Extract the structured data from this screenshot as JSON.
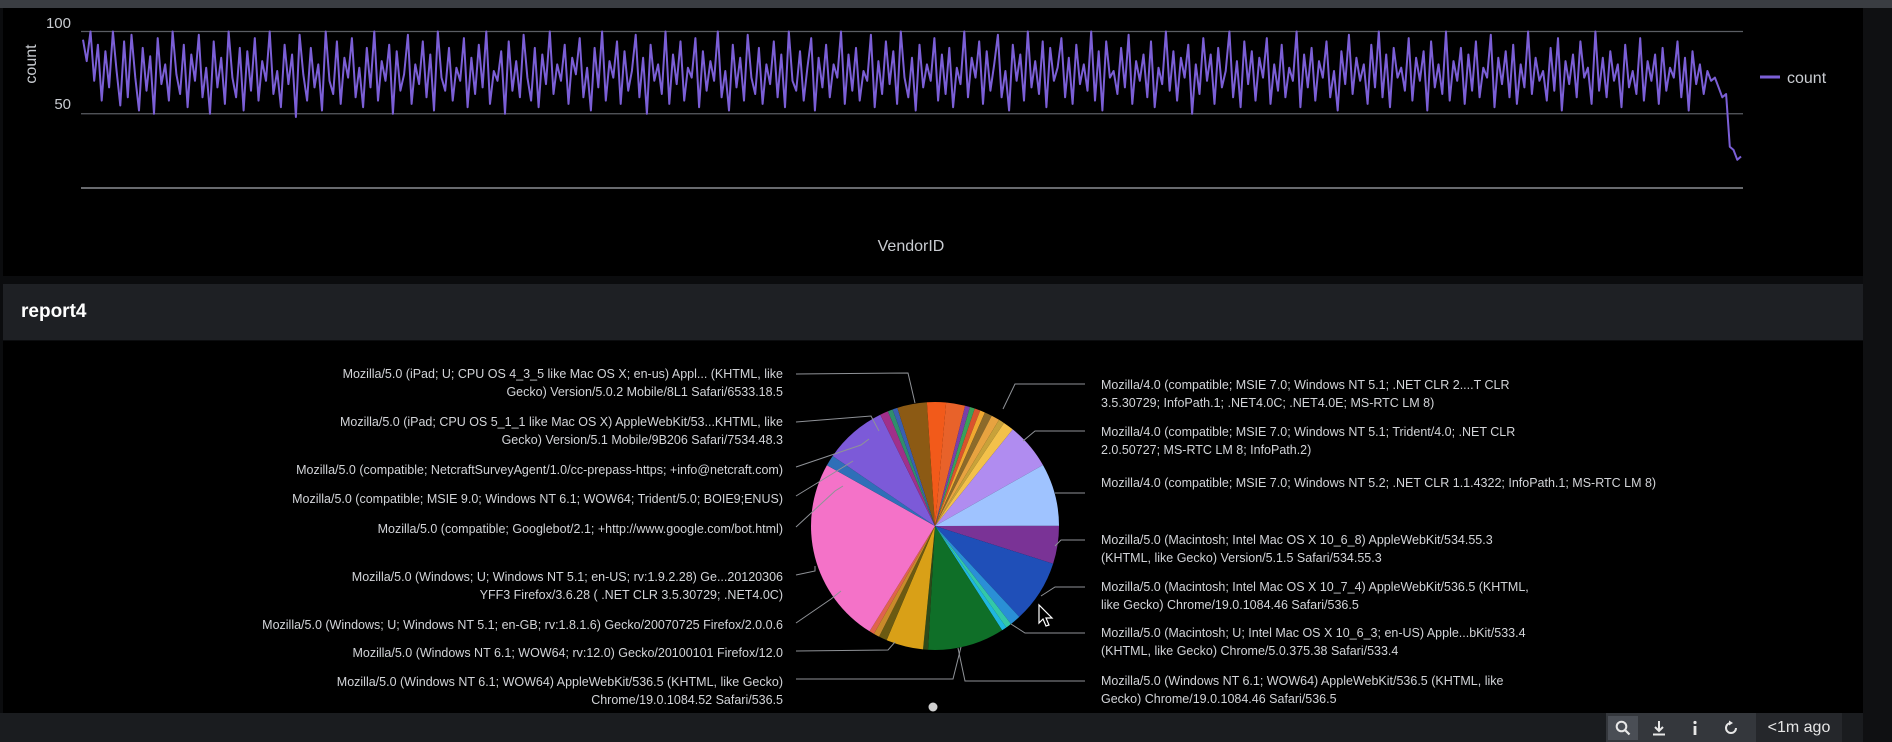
{
  "line_chart": {
    "ylabel": "count",
    "xlabel": "VendorID",
    "legend_label": "count",
    "line_color": "#7b5fd6"
  },
  "report": {
    "title": "report4"
  },
  "chart_data": [
    {
      "type": "line",
      "title": "",
      "xlabel": "VendorID",
      "ylabel": "count",
      "ylim": [
        0,
        110
      ],
      "yticks": [
        50,
        100
      ],
      "grid": true,
      "legend": "right",
      "series": [
        {
          "name": "count",
          "color": "#7b5fd6",
          "values": [
            95,
            82,
            100,
            70,
            92,
            58,
            88,
            66,
            100,
            76,
            55,
            94,
            60,
            98,
            72,
            52,
            90,
            64,
            85,
            50,
            96,
            68,
            80,
            58,
            100,
            74,
            62,
            92,
            54,
            86,
            70,
            98,
            60,
            78,
            50,
            94,
            66,
            84,
            56,
            100,
            72,
            60,
            90,
            52,
            88,
            64,
            96,
            58,
            82,
            70,
            100,
            62,
            76,
            54,
            92,
            68,
            86,
            48,
            98,
            74,
            58,
            90,
            66,
            80,
            52,
            100,
            70,
            62,
            94,
            56,
            84,
            72,
            96,
            60,
            78,
            54,
            90,
            66,
            100,
            58,
            82,
            70,
            92,
            50,
            88,
            64,
            74,
            98,
            56,
            80,
            68,
            94,
            60,
            86,
            52,
            100,
            72,
            64,
            90,
            58,
            78,
            70,
            96,
            54,
            84,
            62,
            92,
            66,
            100,
            56,
            76,
            70,
            88,
            50,
            94,
            64,
            82,
            60,
            98,
            72,
            58,
            90,
            54,
            86,
            68,
            100,
            62,
            80,
            70,
            92,
            56,
            84,
            74,
            96,
            60,
            78,
            52,
            90,
            66,
            100,
            58,
            82,
            72,
            94,
            56,
            88,
            64,
            76,
            98,
            60,
            84,
            50,
            92,
            70,
            80,
            62,
            100,
            56,
            86,
            68,
            94,
            58,
            78,
            72,
            96,
            54,
            88,
            64,
            82,
            70,
            100,
            60,
            76,
            52,
            92,
            66,
            84,
            58,
            98,
            72,
            62,
            90,
            56,
            80,
            68,
            94,
            60,
            86,
            54,
            100,
            70,
            64,
            88,
            58,
            78,
            96,
            52,
            84,
            66,
            92,
            60,
            80,
            72,
            100,
            56,
            86,
            64,
            90,
            58,
            76,
            70,
            98,
            54,
            82,
            62,
            94,
            68,
            88,
            56,
            100,
            72,
            60,
            84,
            52,
            92,
            66,
            80,
            70,
            96,
            58,
            86,
            62,
            90,
            54,
            78,
            68,
            100,
            60,
            84,
            72,
            94,
            56,
            88,
            64,
            80,
            98,
            60,
            76,
            52,
            92,
            70,
            86,
            58,
            100,
            66,
            82,
            62,
            94,
            54,
            90,
            70,
            78,
            96,
            60,
            84,
            56,
            92,
            68,
            80,
            64,
            100,
            58,
            88,
            52,
            94,
            72,
            76,
            62,
            90,
            66,
            98,
            56,
            82,
            70,
            86,
            60,
            94,
            54,
            78,
            68,
            100,
            64,
            88,
            58,
            84,
            72,
            92,
            50,
            80,
            62,
            96,
            70,
            86,
            56,
            90,
            66,
            76,
            100,
            60,
            82,
            54,
            94,
            68,
            88,
            58,
            84,
            72,
            96,
            56,
            80,
            64,
            92,
            60,
            78,
            70,
            100,
            54,
            86,
            66,
            90,
            58,
            82,
            72,
            94,
            60,
            76,
            52,
            88,
            68,
            98,
            62,
            84,
            70,
            80,
            56,
            92,
            66,
            100,
            60,
            86,
            54,
            90,
            72,
            78,
            64,
            96,
            58,
            84,
            70,
            88,
            52,
            94,
            66,
            80,
            62,
            100,
            58,
            82,
            70,
            90,
            56,
            86,
            64,
            94,
            60,
            78,
            72,
            98,
            54,
            84,
            68,
            88,
            60,
            92,
            56,
            80,
            66,
            100,
            62,
            84,
            70,
            76,
            58,
            90,
            64,
            96,
            52,
            82,
            68,
            86,
            60,
            94,
            72,
            78,
            56,
            100,
            64,
            84,
            60,
            88,
            70,
            80,
            54,
            92,
            66,
            76,
            62,
            96,
            58,
            82,
            70,
            86,
            56,
            90,
            64,
            78,
            72,
            94,
            60,
            84,
            52,
            88,
            68,
            80,
            62,
            76,
            70,
            72,
            66,
            60,
            62,
            30,
            28,
            22,
            24
          ]
        }
      ]
    },
    {
      "type": "pie",
      "title": "",
      "legend": "none",
      "labels_outside": [
        "Mozilla/5.0 (iPad; U; CPU OS 4_3_5 like Mac OS X; en-us) Appl... (KHTML, like Gecko) Version/5.0.2 Mobile/8L1 Safari/6533.18.5",
        "Mozilla/5.0 (iPad; CPU OS 5_1_1 like Mac OS X) AppleWebKit/53...KHTML, like Gecko) Version/5.1 Mobile/9B206 Safari/7534.48.3",
        "Mozilla/5.0 (compatible; NetcraftSurveyAgent/1.0/cc-prepass-https; +info@netcraft.com)",
        "Mozilla/5.0 (compatible; MSIE 9.0; Windows NT 6.1; WOW64; Trident/5.0; BOIE9;ENUS)",
        "Mozilla/5.0 (compatible; Googlebot/2.1; +http://www.google.com/bot.html)",
        "Mozilla/5.0 (Windows; U; Windows NT 5.1; en-US; rv:1.9.2.28) Ge...20120306 YFF3 Firefox/3.6.28 ( .NET CLR 3.5.30729; .NET4.0C)",
        "Mozilla/5.0 (Windows; U; Windows NT 5.1; en-GB; rv:1.8.1.6) Gecko/20070725 Firefox/2.0.0.6",
        "Mozilla/5.0 (Windows NT 6.1; WOW64; rv:12.0) Gecko/20100101 Firefox/12.0",
        "Mozilla/5.0 (Windows NT 6.1; WOW64) AppleWebKit/536.5 (KHTML, like Gecko) Chrome/19.0.1084.52 Safari/536.5",
        "Mozilla/4.0 (compatible; MSIE 7.0; Windows NT 5.1; .NET CLR 2....T CLR 3.5.30729; InfoPath.1; .NET4.0C; .NET4.0E; MS-RTC LM 8)",
        "Mozilla/4.0 (compatible; MSIE 7.0; Windows NT 5.1; Trident/4.0; .NET CLR 2.0.50727; MS-RTC LM 8; InfoPath.2)",
        "Mozilla/4.0 (compatible; MSIE 7.0; Windows NT 5.2; .NET CLR 1.1.4322; InfoPath.1; MS-RTC LM 8)",
        "Mozilla/5.0 (Macintosh; Intel Mac OS X 10_6_8) AppleWebKit/534.55.3 (KHTML, like Gecko) Version/5.1.5 Safari/534.55.3",
        "Mozilla/5.0 (Macintosh; Intel Mac OS X 10_7_4) AppleWebKit/536.5 (KHTML, like Gecko) Chrome/19.0.1084.46 Safari/536.5",
        "Mozilla/5.0 (Macintosh; U; Intel Mac OS X 10_6_3; en-US) Apple...bKit/533.4 (KHTML, like Gecko) Chrome/5.0.375.38 Safari/533.4",
        "Mozilla/5.0 (Windows NT 6.1; WOW64) AppleWebKit/536.5 (KHTML, like Gecko) Chrome/19.0.1084.46 Safari/536.5"
      ],
      "slices": [
        {
          "value": 2.3,
          "color": "#e8622a"
        },
        {
          "value": 0.6,
          "color": "#7a3fa8"
        },
        {
          "value": 0.6,
          "color": "#3aa05a"
        },
        {
          "value": 0.7,
          "color": "#d9532d"
        },
        {
          "value": 0.6,
          "color": "#f0a830"
        },
        {
          "value": 0.9,
          "color": "#8c6a2a"
        },
        {
          "value": 1.0,
          "color": "#e7a340"
        },
        {
          "value": 0.7,
          "color": "#c8a23a"
        },
        {
          "value": 1.3,
          "color": "#f3c14a"
        },
        {
          "value": 5.6,
          "color": "#b08cf0"
        },
        {
          "value": 7.6,
          "color": "#9fc3ff"
        },
        {
          "value": 4.6,
          "color": "#7a3396"
        },
        {
          "value": 7.6,
          "color": "#1f4fb8"
        },
        {
          "value": 1.3,
          "color": "#2a8fd6"
        },
        {
          "value": 0.7,
          "color": "#33c8a8"
        },
        {
          "value": 0.6,
          "color": "#1fb7e0"
        },
        {
          "value": 9.3,
          "color": "#0f6f28"
        },
        {
          "value": 0.6,
          "color": "#2d4a1a"
        },
        {
          "value": 4.5,
          "color": "#d9a017"
        },
        {
          "value": 1.0,
          "color": "#6b5a12"
        },
        {
          "value": 0.7,
          "color": "#c98a2a"
        },
        {
          "value": 0.6,
          "color": "#e0644a"
        },
        {
          "value": 22.6,
          "color": "#f472c8"
        },
        {
          "value": 1.3,
          "color": "#2f6fb8"
        },
        {
          "value": 7.6,
          "color": "#7c5ad8"
        },
        {
          "value": 1.0,
          "color": "#a0308a"
        },
        {
          "value": 0.6,
          "color": "#2f8e6c"
        },
        {
          "value": 0.6,
          "color": "#3a5fb0"
        },
        {
          "value": 3.6,
          "color": "#8c5a14"
        },
        {
          "value": 2.3,
          "color": "#f25a1a"
        }
      ]
    }
  ],
  "toolbar": {
    "search_icon": "search-icon",
    "download_icon": "download-icon",
    "info_icon": "info-icon",
    "refresh_icon": "refresh-icon",
    "last_updated": "<1m ago"
  }
}
